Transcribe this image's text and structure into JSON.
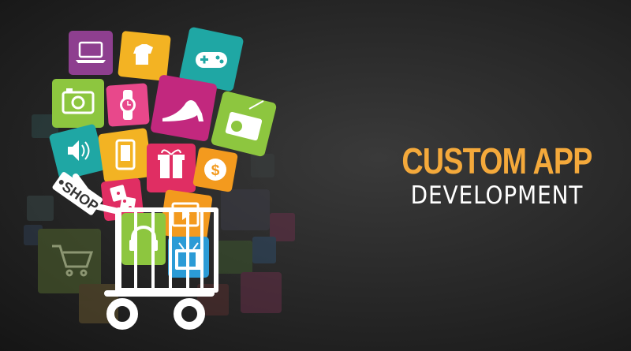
{
  "headline": {
    "line1": "CUSTOM APP",
    "line2": "DEVELOPMENT"
  },
  "cart": {
    "tag_text": "SHOP"
  },
  "colors": {
    "accent": "#F4A93B",
    "text_white": "#FFFFFF",
    "background": "#262626"
  },
  "icons": [
    {
      "name": "laptop-icon",
      "color": "#8E3F8F"
    },
    {
      "name": "shirt-icon",
      "color": "#F3B323"
    },
    {
      "name": "gamepad-icon",
      "color": "#1FA7A4"
    },
    {
      "name": "camera-icon",
      "color": "#8DC63F"
    },
    {
      "name": "watch-icon",
      "color": "#E8488B"
    },
    {
      "name": "heel-shoe-icon",
      "color": "#C2287E"
    },
    {
      "name": "radio-icon",
      "color": "#8DC63F"
    },
    {
      "name": "speaker-icon",
      "color": "#1FA7A4"
    },
    {
      "name": "phone-icon",
      "color": "#F3B323"
    },
    {
      "name": "gift-icon",
      "color": "#E02E63"
    },
    {
      "name": "dollar-icon",
      "color": "#F39A1E"
    },
    {
      "name": "dice-icon",
      "color": "#E02E63"
    },
    {
      "name": "video-icon",
      "color": "#F39A1E"
    },
    {
      "name": "headphones-icon",
      "color": "#8DC63F"
    },
    {
      "name": "tv-icon",
      "color": "#2B9BD6"
    },
    {
      "name": "shopping-cart-icon",
      "color": "#5B6E35"
    }
  ]
}
